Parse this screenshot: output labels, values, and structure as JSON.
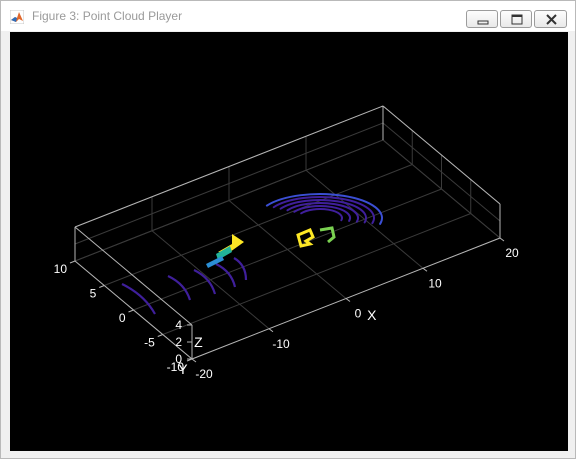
{
  "window": {
    "title": "Figure 3: Point Cloud Player",
    "icon": "matlab-logo-icon",
    "controls": {
      "minimize": "minimize-icon",
      "maximize": "maximize-icon",
      "close": "close-icon"
    }
  },
  "colors": {
    "background": "#000000",
    "axis": "#b4b4b4",
    "grid": "#3a3a3a",
    "tick_text": "#ffffff",
    "colormap": [
      "#3f1f9b",
      "#3b4fd4",
      "#2b8fd6",
      "#22b39a",
      "#7ad151",
      "#fde725"
    ]
  },
  "chart_data": {
    "type": "scatter",
    "projection": "3d",
    "grid": true,
    "colormap": "parula",
    "axes": {
      "x": {
        "label": "X",
        "range": [
          -20,
          20
        ],
        "ticks": [
          "-20",
          "-10",
          "0",
          "10",
          "20"
        ]
      },
      "y": {
        "label": "Y",
        "range": [
          -10,
          10
        ],
        "ticks": [
          "-10",
          "-5",
          "0",
          "5",
          "10"
        ]
      },
      "z": {
        "label": "Z",
        "range": [
          0,
          4
        ],
        "ticks": [
          "0",
          "2",
          "4"
        ]
      }
    }
  }
}
